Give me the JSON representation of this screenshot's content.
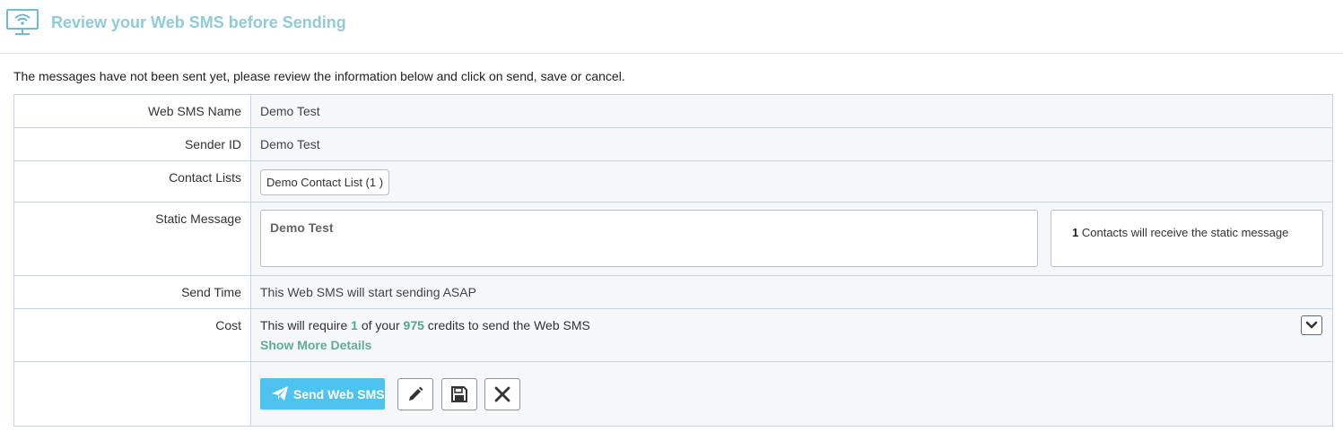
{
  "header": {
    "title": "Review your Web SMS before Sending",
    "icon": "wifi-monitor-icon",
    "accent_color": "#8fcbd9"
  },
  "intro": "The messages have not been sent yet, please review the information below and click on send, save or cancel.",
  "review": {
    "name_label": "Web SMS Name",
    "name_value": "Demo Test",
    "sender_label": "Sender ID",
    "sender_value": "Demo Test",
    "lists_label": "Contact Lists",
    "lists": [
      "Demo Contact List (1 )"
    ],
    "static_label": "Static Message",
    "static_message": "Demo Test",
    "static_count": "1",
    "static_count_text": "Contacts will receive the static message",
    "time_label": "Send Time",
    "time_value": "This Web SMS will start sending ASAP",
    "cost_label": "Cost",
    "cost_prefix": "This will require",
    "cost_credits": "1",
    "cost_middle": "of your",
    "cost_total": "975",
    "cost_suffix": "credits to send the Web SMS",
    "show_more": "Show More Details"
  },
  "actions": {
    "send_label": "Send Web SMS",
    "send_color": "#4ec3ef",
    "icons": [
      "paper-plane-icon",
      "pencil-icon",
      "floppy-disk-icon",
      "close-icon",
      "chevron-down-icon"
    ]
  }
}
